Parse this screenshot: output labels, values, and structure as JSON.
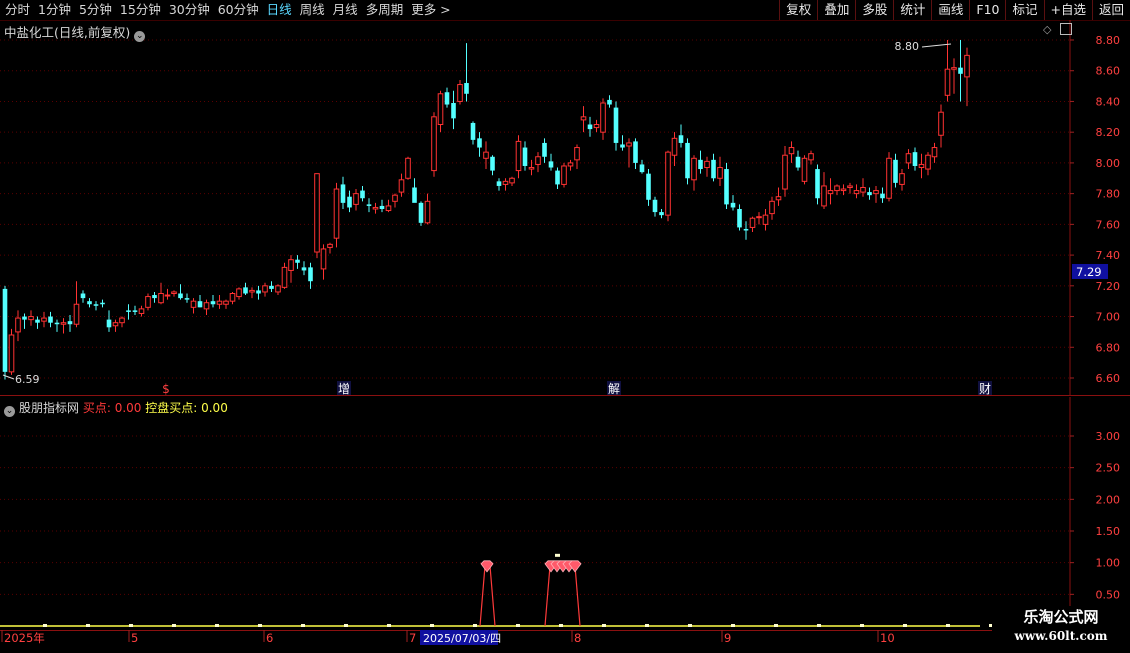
{
  "toolbar": {
    "period_tabs": [
      "分时",
      "1分钟",
      "5分钟",
      "15分钟",
      "30分钟",
      "60分钟",
      "日线",
      "周线",
      "月线",
      "多周期",
      "更多 >"
    ],
    "active_tab": "日线",
    "right_tabs": [
      "复权",
      "叠加",
      "多股",
      "统计",
      "画线",
      "F10",
      "标记",
      "+自选",
      "返回"
    ]
  },
  "main_chart": {
    "title": "中盐化工(日线,前复权)",
    "price_ticks": [
      "8.80",
      "8.60",
      "8.40",
      "8.20",
      "8.00",
      "7.80",
      "7.60",
      "7.40",
      "7.20",
      "7.00",
      "6.80",
      "6.60"
    ],
    "current_price_label": "7.29",
    "high_marker": "8.80",
    "low_marker": "6.59",
    "event_markers": [
      "$",
      "增",
      "解",
      "财"
    ],
    "colors": {
      "up": "#ff3232",
      "down": "#54ffff",
      "grid": "#5a0000"
    }
  },
  "chart_data": {
    "type": "candlestick",
    "ylim": [
      6.55,
      8.85
    ],
    "note_candles": "open/high/low/close per day, left to right",
    "candles": [
      [
        7.18,
        7.2,
        6.59,
        6.64
      ],
      [
        6.64,
        6.92,
        6.62,
        6.88
      ],
      [
        6.9,
        7.04,
        6.84,
        6.99
      ],
      [
        7.0,
        7.02,
        6.92,
        6.98
      ],
      [
        6.98,
        7.04,
        6.94,
        7.0
      ],
      [
        6.98,
        7.0,
        6.92,
        6.96
      ],
      [
        6.97,
        7.03,
        6.93,
        6.99
      ],
      [
        7.0,
        7.03,
        6.93,
        6.96
      ],
      [
        6.96,
        6.98,
        6.9,
        6.95
      ],
      [
        6.95,
        6.99,
        6.89,
        6.96
      ],
      [
        6.97,
        7.01,
        6.9,
        6.95
      ],
      [
        6.95,
        7.23,
        6.93,
        7.08
      ],
      [
        7.15,
        7.17,
        7.09,
        7.12
      ],
      [
        7.1,
        7.12,
        7.06,
        7.08
      ],
      [
        7.08,
        7.1,
        7.04,
        7.07
      ],
      [
        7.09,
        7.11,
        7.06,
        7.08
      ],
      [
        6.98,
        7.04,
        6.9,
        6.93
      ],
      [
        6.94,
        6.98,
        6.9,
        6.96
      ],
      [
        6.96,
        7.0,
        6.93,
        6.99
      ],
      [
        7.04,
        7.08,
        6.98,
        7.03
      ],
      [
        7.04,
        7.07,
        7.01,
        7.03
      ],
      [
        7.02,
        7.07,
        7.0,
        7.05
      ],
      [
        7.06,
        7.15,
        7.04,
        7.13
      ],
      [
        7.14,
        7.16,
        7.09,
        7.12
      ],
      [
        7.09,
        7.22,
        7.08,
        7.15
      ],
      [
        7.14,
        7.18,
        7.11,
        7.14
      ],
      [
        7.15,
        7.17,
        7.13,
        7.16
      ],
      [
        7.15,
        7.21,
        7.11,
        7.12
      ],
      [
        7.12,
        7.15,
        7.09,
        7.11
      ],
      [
        7.06,
        7.12,
        7.02,
        7.1
      ],
      [
        7.1,
        7.14,
        7.06,
        7.06
      ],
      [
        7.05,
        7.11,
        7.01,
        7.09
      ],
      [
        7.1,
        7.14,
        7.06,
        7.08
      ],
      [
        7.08,
        7.14,
        7.05,
        7.1
      ],
      [
        7.08,
        7.11,
        7.05,
        7.1
      ],
      [
        7.1,
        7.16,
        7.08,
        7.15
      ],
      [
        7.13,
        7.19,
        7.11,
        7.18
      ],
      [
        7.19,
        7.22,
        7.14,
        7.15
      ],
      [
        7.16,
        7.19,
        7.12,
        7.17
      ],
      [
        7.17,
        7.2,
        7.11,
        7.15
      ],
      [
        7.16,
        7.22,
        7.13,
        7.2
      ],
      [
        7.2,
        7.23,
        7.16,
        7.18
      ],
      [
        7.16,
        7.21,
        7.14,
        7.2
      ],
      [
        7.19,
        7.35,
        7.18,
        7.32
      ],
      [
        7.3,
        7.4,
        7.22,
        7.37
      ],
      [
        7.37,
        7.4,
        7.31,
        7.35
      ],
      [
        7.32,
        7.36,
        7.27,
        7.3
      ],
      [
        7.32,
        7.35,
        7.18,
        7.23
      ],
      [
        7.42,
        7.93,
        7.38,
        7.93
      ],
      [
        7.31,
        7.47,
        7.24,
        7.44
      ],
      [
        7.45,
        7.48,
        7.41,
        7.47
      ],
      [
        7.51,
        7.87,
        7.45,
        7.83
      ],
      [
        7.86,
        7.91,
        7.7,
        7.74
      ],
      [
        7.78,
        7.82,
        7.68,
        7.71
      ],
      [
        7.73,
        7.83,
        7.69,
        7.8
      ],
      [
        7.82,
        7.85,
        7.75,
        7.77
      ],
      [
        7.73,
        7.77,
        7.68,
        7.72
      ],
      [
        7.7,
        7.74,
        7.67,
        7.71
      ],
      [
        7.72,
        7.76,
        7.68,
        7.7
      ],
      [
        7.69,
        7.76,
        7.68,
        7.72
      ],
      [
        7.75,
        7.8,
        7.71,
        7.79
      ],
      [
        7.81,
        7.93,
        7.78,
        7.89
      ],
      [
        7.9,
        8.04,
        7.89,
        8.03
      ],
      [
        7.84,
        7.9,
        7.79,
        7.74
      ],
      [
        7.74,
        7.75,
        7.59,
        7.61
      ],
      [
        7.61,
        7.8,
        7.6,
        7.75
      ],
      [
        7.95,
        8.33,
        7.91,
        8.3
      ],
      [
        8.25,
        8.47,
        8.2,
        8.45
      ],
      [
        8.46,
        8.49,
        8.36,
        8.38
      ],
      [
        8.39,
        8.47,
        8.22,
        8.29
      ],
      [
        8.4,
        8.54,
        8.38,
        8.51
      ],
      [
        8.52,
        8.78,
        8.4,
        8.45
      ],
      [
        8.26,
        8.27,
        8.12,
        8.15
      ],
      [
        8.16,
        8.2,
        8.04,
        8.1
      ],
      [
        8.03,
        8.14,
        7.96,
        8.07
      ],
      [
        8.04,
        8.05,
        7.92,
        7.95
      ],
      [
        7.88,
        7.9,
        7.82,
        7.85
      ],
      [
        7.86,
        7.9,
        7.82,
        7.88
      ],
      [
        7.87,
        7.91,
        7.85,
        7.9
      ],
      [
        7.95,
        8.18,
        7.9,
        8.14
      ],
      [
        8.1,
        8.14,
        7.95,
        7.98
      ],
      [
        7.96,
        8.02,
        7.92,
        7.97
      ],
      [
        7.99,
        8.07,
        7.94,
        8.04
      ],
      [
        8.13,
        8.16,
        8.0,
        8.04
      ],
      [
        8.01,
        8.06,
        7.95,
        7.97
      ],
      [
        7.95,
        7.97,
        7.83,
        7.86
      ],
      [
        7.86,
        8.0,
        7.84,
        7.98
      ],
      [
        7.98,
        8.02,
        7.95,
        8.0
      ],
      [
        8.02,
        8.12,
        7.96,
        8.1
      ],
      [
        8.28,
        8.37,
        8.2,
        8.3
      ],
      [
        8.25,
        8.3,
        8.17,
        8.22
      ],
      [
        8.23,
        8.28,
        8.2,
        8.25
      ],
      [
        8.2,
        8.42,
        8.15,
        8.39
      ],
      [
        8.41,
        8.44,
        8.36,
        8.38
      ],
      [
        8.36,
        8.4,
        8.08,
        8.13
      ],
      [
        8.12,
        8.18,
        8.08,
        8.1
      ],
      [
        8.11,
        8.16,
        7.97,
        8.13
      ],
      [
        8.14,
        8.16,
        7.96,
        8.0
      ],
      [
        7.99,
        8.02,
        7.93,
        7.94
      ],
      [
        7.93,
        7.96,
        7.72,
        7.76
      ],
      [
        7.76,
        7.78,
        7.65,
        7.68
      ],
      [
        7.68,
        7.7,
        7.64,
        7.66
      ],
      [
        7.66,
        8.08,
        7.62,
        8.07
      ],
      [
        8.05,
        8.2,
        7.98,
        8.16
      ],
      [
        8.18,
        8.25,
        8.1,
        8.13
      ],
      [
        8.13,
        8.16,
        7.86,
        7.9
      ],
      [
        7.89,
        8.05,
        7.82,
        8.03
      ],
      [
        8.02,
        8.08,
        7.93,
        7.96
      ],
      [
        7.97,
        8.04,
        7.91,
        8.01
      ],
      [
        8.02,
        8.06,
        7.88,
        7.9
      ],
      [
        7.9,
        8.04,
        7.85,
        7.97
      ],
      [
        7.96,
        8.0,
        7.7,
        7.73
      ],
      [
        7.74,
        7.79,
        7.69,
        7.71
      ],
      [
        7.7,
        7.73,
        7.56,
        7.58
      ],
      [
        7.57,
        7.62,
        7.5,
        7.56
      ],
      [
        7.58,
        7.65,
        7.55,
        7.64
      ],
      [
        7.65,
        7.68,
        7.6,
        7.65
      ],
      [
        7.6,
        7.7,
        7.56,
        7.66
      ],
      [
        7.67,
        7.78,
        7.63,
        7.75
      ],
      [
        7.76,
        7.84,
        7.72,
        7.78
      ],
      [
        7.83,
        8.11,
        7.78,
        8.05
      ],
      [
        8.06,
        8.14,
        8.0,
        8.1
      ],
      [
        8.04,
        8.08,
        7.95,
        7.97
      ],
      [
        7.88,
        8.05,
        7.86,
        8.03
      ],
      [
        8.02,
        8.08,
        7.99,
        8.06
      ],
      [
        7.96,
        7.99,
        7.73,
        7.77
      ],
      [
        7.72,
        7.94,
        7.7,
        7.85
      ],
      [
        7.8,
        7.9,
        7.73,
        7.82
      ],
      [
        7.82,
        7.86,
        7.79,
        7.85
      ],
      [
        7.82,
        7.86,
        7.79,
        7.83
      ],
      [
        7.84,
        7.87,
        7.8,
        7.85
      ],
      [
        7.8,
        7.86,
        7.77,
        7.82
      ],
      [
        7.81,
        7.9,
        7.78,
        7.84
      ],
      [
        7.81,
        7.84,
        7.76,
        7.79
      ],
      [
        7.8,
        7.85,
        7.74,
        7.82
      ],
      [
        7.8,
        7.84,
        7.74,
        7.77
      ],
      [
        7.77,
        8.07,
        7.75,
        8.03
      ],
      [
        8.02,
        8.06,
        7.84,
        7.87
      ],
      [
        7.86,
        7.96,
        7.82,
        7.93
      ],
      [
        8.0,
        8.09,
        7.96,
        8.06
      ],
      [
        8.07,
        8.1,
        7.95,
        7.98
      ],
      [
        7.97,
        8.06,
        7.9,
        7.99
      ],
      [
        7.96,
        8.07,
        7.92,
        8.05
      ],
      [
        8.04,
        8.13,
        8.0,
        8.1
      ],
      [
        8.18,
        8.38,
        8.1,
        8.33
      ],
      [
        8.44,
        8.8,
        8.4,
        8.61
      ],
      [
        8.61,
        8.68,
        8.45,
        8.62
      ],
      [
        8.62,
        8.8,
        8.4,
        8.58
      ],
      [
        8.56,
        8.75,
        8.37,
        8.7
      ]
    ]
  },
  "indicator": {
    "name": "股朋指标网",
    "series": [
      {
        "label": "买点: 0.00",
        "color": "#ff3a3a"
      },
      {
        "label": "控盘买点: 0.00",
        "color": "#ffff4a"
      }
    ],
    "y_ticks": [
      "3.00",
      "2.50",
      "2.00",
      "1.50",
      "1.00",
      "0.50"
    ],
    "signal_values": [
      0,
      0,
      0,
      0,
      0,
      0,
      0,
      0,
      0,
      0,
      0,
      0,
      0,
      0,
      0,
      0,
      0,
      0,
      0,
      0,
      0,
      0,
      0,
      0,
      0,
      0,
      0,
      0,
      0,
      0,
      0,
      0,
      0,
      0,
      0,
      0,
      0,
      0,
      0,
      0,
      0,
      0,
      0,
      0,
      0,
      0,
      0,
      0,
      0,
      0,
      0,
      0,
      0,
      0,
      0,
      0,
      0,
      0,
      0,
      0,
      0,
      0,
      0,
      0,
      0,
      0,
      0,
      0,
      0,
      0,
      0,
      0,
      0,
      0,
      0,
      0,
      0,
      0,
      0,
      0,
      0,
      0,
      0,
      0,
      0,
      0,
      0,
      0,
      0,
      0,
      0,
      0,
      0,
      0,
      0,
      0,
      0,
      0,
      0,
      0,
      0,
      0,
      0,
      0,
      0,
      0,
      0,
      0,
      0,
      0,
      0,
      0,
      0,
      0,
      0,
      0,
      0,
      0,
      0,
      0,
      0,
      0,
      0,
      0,
      0,
      0,
      0,
      0,
      0,
      0,
      0,
      0,
      0,
      0,
      0,
      0,
      0,
      0,
      0,
      0,
      0,
      0,
      0,
      0,
      0,
      0,
      0,
      0,
      0,
      0,
      0,
      0,
      0,
      0,
      0,
      0,
      0,
      0,
      0,
      0,
      0,
      0,
      0
    ],
    "signal_days": [
      59,
      66,
      67,
      68,
      69
    ]
  },
  "xaxis": {
    "labels": [
      "2025年",
      "5",
      "6",
      "7",
      "8",
      "9",
      "10"
    ],
    "cursor_date": "2025/07/03/四"
  },
  "watermark": {
    "line1": "乐淘公式网",
    "line2": "www.60lt.com"
  }
}
